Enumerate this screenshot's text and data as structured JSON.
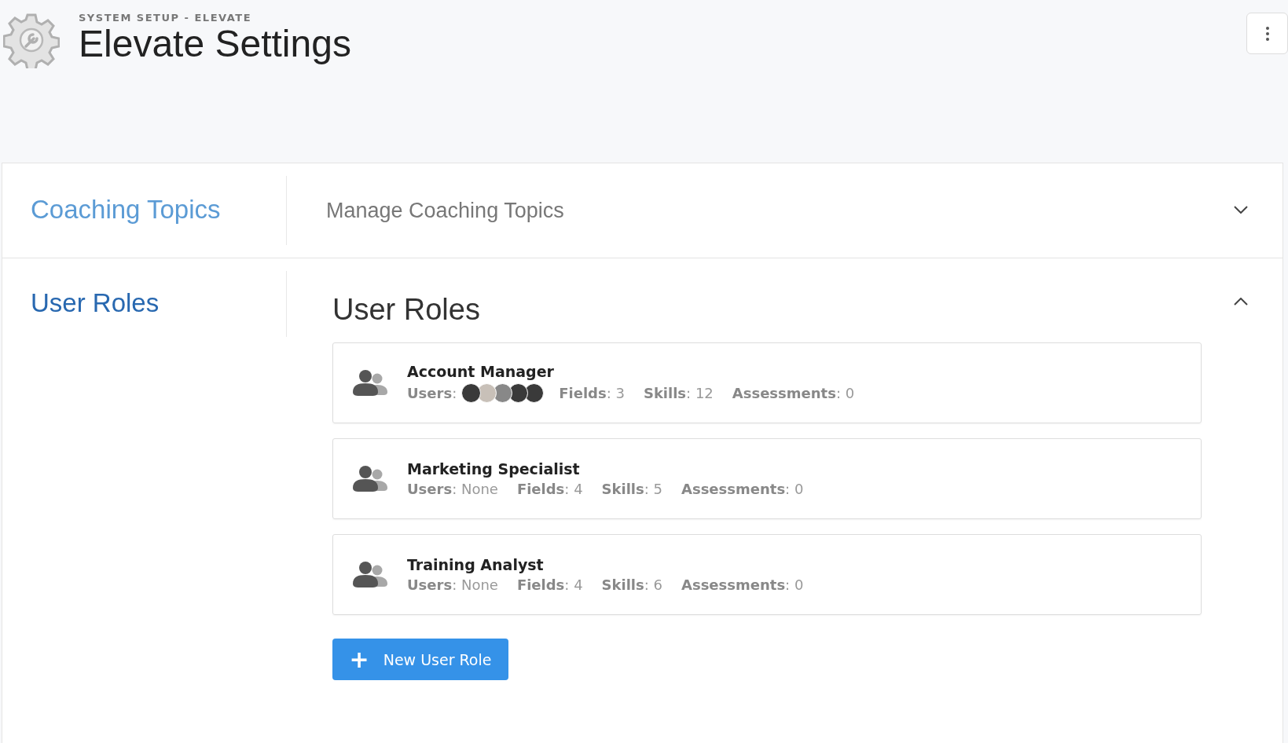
{
  "header": {
    "breadcrumb": "SYSTEM SETUP - ELEVATE",
    "title": "Elevate Settings"
  },
  "sections": [
    {
      "title": "Coaching Topics",
      "expanded": false,
      "summary": "Manage Coaching Topics"
    },
    {
      "title": "User Roles",
      "expanded": true,
      "heading": "User Roles",
      "roles": [
        {
          "name": "Account Manager",
          "users": {
            "kind": "avatars",
            "label": "**Users**:",
            "avatars": [
              {
                "kind": "photo"
              },
              {
                "kind": "photo"
              },
              {
                "kind": "photo"
              },
              {
                "kind": "photo"
              },
              {
                "kind": "photo"
              }
            ]
          },
          "stats": [
            "**Fields**: 3",
            "**Skills**: 12",
            "**Assessments**: 0"
          ]
        },
        {
          "name": "Marketing Specialist",
          "users": {
            "kind": "text",
            "text": "**Users**: None"
          },
          "stats": [
            "**Fields**: 4",
            "**Skills**: 5",
            "**Assessments**: 0"
          ]
        },
        {
          "name": "Training Analyst",
          "users": {
            "kind": "text",
            "text": "**Users**: None"
          },
          "stats": [
            "**Fields**: 4",
            "**Skills**: 6",
            "**Assessments**: 0"
          ]
        }
      ],
      "button": {
        "icon": "+",
        "label": "New User Role"
      }
    }
  ]
}
